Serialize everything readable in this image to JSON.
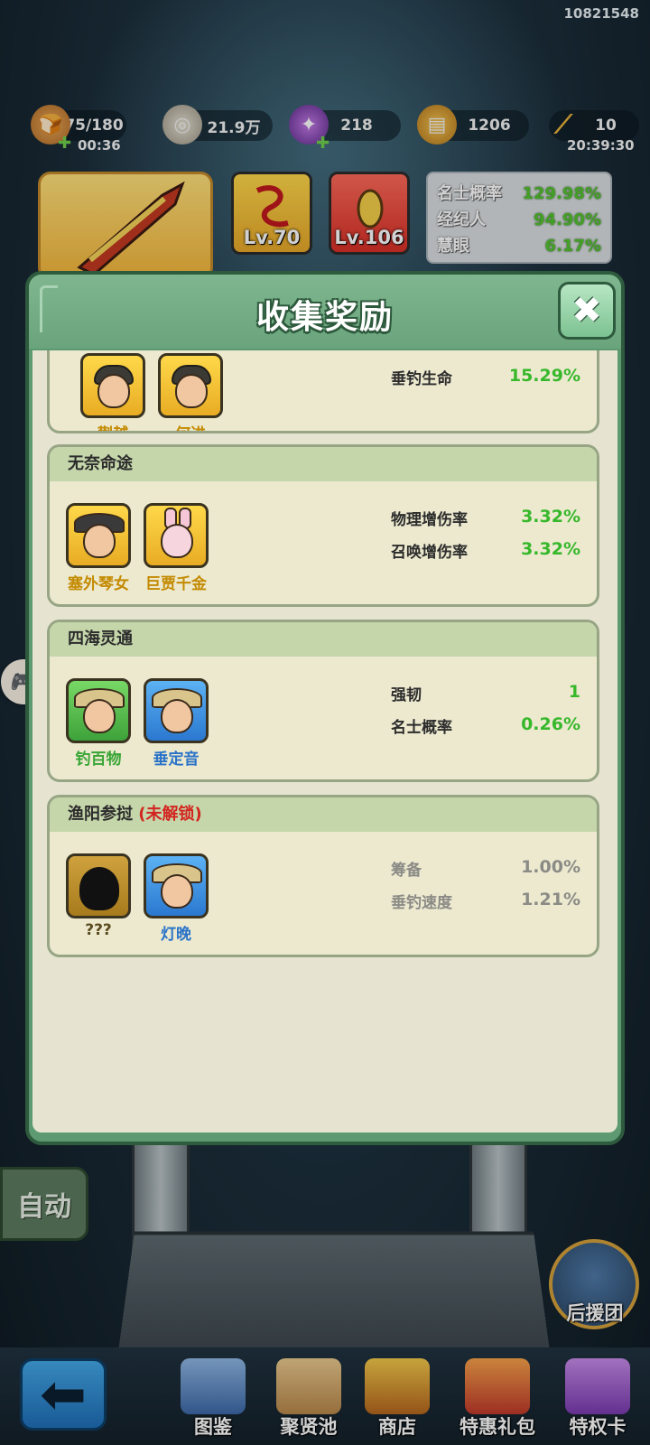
{
  "game_id": "10821548",
  "resources": {
    "stamina": {
      "value": "75/180",
      "timer": "00:36",
      "icon": "bread-icon"
    },
    "coins": {
      "value": "21.9万",
      "icon": "coin-icon"
    },
    "gems": {
      "value": "218",
      "icon": "purple-gem-icon"
    },
    "tickets": {
      "value": "1206",
      "icon": "ticket-icon"
    },
    "rods": {
      "value": "10",
      "timer": "20:39:30",
      "icon": "fishing-rod-icon"
    }
  },
  "equipment": {
    "item1_level": "Lv.70",
    "item2_level": "Lv.106"
  },
  "top_stats": [
    {
      "name": "名士概率",
      "value": "129.98%"
    },
    {
      "name": "经纪人",
      "value": "94.90%"
    },
    {
      "name": "慧眼",
      "value": "6.17%"
    }
  ],
  "modal": {
    "title": "收集奖励",
    "close_symbol": "✖"
  },
  "sets": [
    {
      "name": "",
      "heroes": [
        {
          "name": "蒯越",
          "rarity": "gold"
        },
        {
          "name": "何进",
          "rarity": "gold"
        }
      ],
      "bonuses": [
        {
          "name": "垂钓生命",
          "value": "15.29%"
        }
      ]
    },
    {
      "name": "无奈命途",
      "heroes": [
        {
          "name": "塞外琴女",
          "rarity": "gold"
        },
        {
          "name": "巨贾千金",
          "rarity": "gold"
        }
      ],
      "bonuses": [
        {
          "name": "物理增伤率",
          "value": "3.32%"
        },
        {
          "name": "召唤增伤率",
          "value": "3.32%"
        }
      ]
    },
    {
      "name": "四海灵通",
      "heroes": [
        {
          "name": "钓百物",
          "rarity": "green"
        },
        {
          "name": "垂定音",
          "rarity": "blue"
        }
      ],
      "bonuses": [
        {
          "name": "强韧",
          "value": "1"
        },
        {
          "name": "名士概率",
          "value": "0.26%"
        }
      ]
    },
    {
      "name": "渔阳参挝",
      "locked_label": "(未解锁)",
      "heroes": [
        {
          "name": "???",
          "rarity": "gold"
        },
        {
          "name": "灯晚",
          "rarity": "blue"
        }
      ],
      "bonuses": [
        {
          "name": "筹备",
          "value": "1.00%"
        },
        {
          "name": "垂钓速度",
          "value": "1.21%"
        }
      ]
    }
  ],
  "controls": {
    "auto_label": "自动",
    "helper_label": "后援团"
  },
  "bottom_nav": [
    {
      "label": "图鉴",
      "icon": "book-icon"
    },
    {
      "label": "聚贤池",
      "icon": "scroll-map-icon"
    },
    {
      "label": "商店",
      "icon": "treasure-pot-icon"
    },
    {
      "label": "特惠礼包",
      "icon": "gift-chest-icon"
    },
    {
      "label": "特权卡",
      "icon": "privilege-card-icon"
    }
  ],
  "colors": {
    "modal_border": "#2e5a3d",
    "bonus_active": "#37b82b",
    "locked": "#d3251f"
  }
}
